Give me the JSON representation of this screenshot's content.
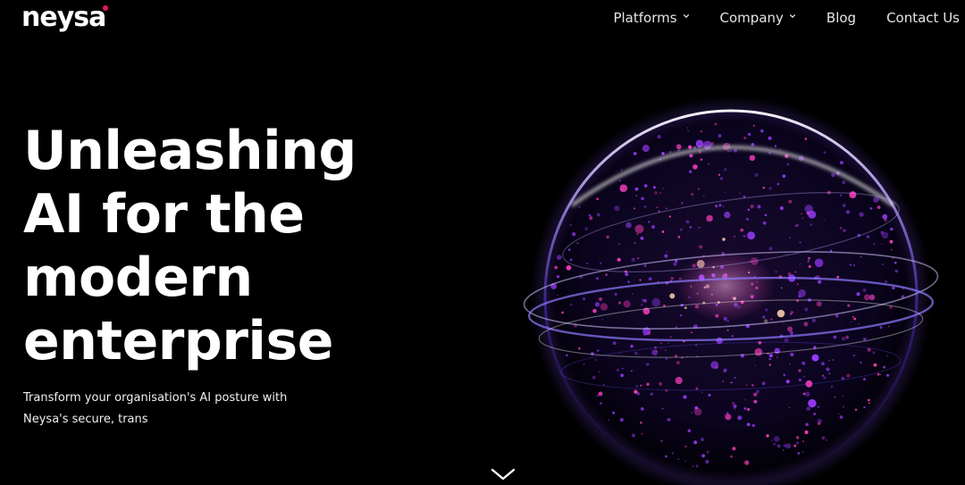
{
  "brand": {
    "name": "neysa",
    "accent_color": "#e8175d"
  },
  "nav": {
    "items": [
      {
        "label": "Platforms",
        "has_dropdown": true
      },
      {
        "label": "Company",
        "has_dropdown": true
      },
      {
        "label": "Blog",
        "has_dropdown": false
      },
      {
        "label": "Contact Us",
        "has_dropdown": false
      }
    ]
  },
  "hero": {
    "title_lines": [
      "Unleashing",
      "AI for the",
      "modern",
      "enterprise"
    ],
    "subtitle_lines": [
      "Transform your organisation's AI posture with",
      "Neysa's secure, trans"
    ]
  },
  "icons": {
    "nav_dropdown": "chevron-down-icon",
    "scroll": "chevron-down-icon",
    "visual": "globe-particles-icon"
  },
  "colors": {
    "background": "#000000",
    "sphere_glow": "#8a5cff",
    "particle_purple": "#9b3cff",
    "particle_pink": "#ff3fbf"
  }
}
